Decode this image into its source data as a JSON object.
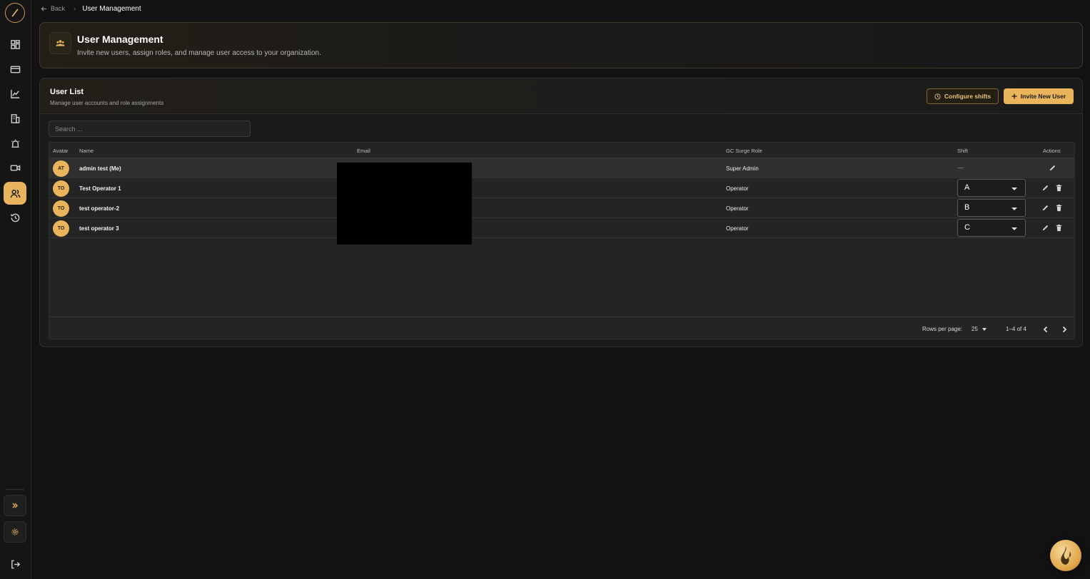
{
  "breadcrumb": {
    "back_label": "Back",
    "current": "User Management"
  },
  "sidebar": {
    "items": [
      {
        "icon": "dashboard-icon"
      },
      {
        "icon": "credit-card-icon"
      },
      {
        "icon": "line-chart-icon"
      },
      {
        "icon": "building-icon"
      },
      {
        "icon": "alarm-siren-icon"
      },
      {
        "icon": "video-camera-icon"
      },
      {
        "icon": "users-icon",
        "active": true
      },
      {
        "icon": "history-icon"
      }
    ],
    "expand_icon": "double-chevron-right-icon",
    "settings_icon": "gear-icon",
    "logout_icon": "logout-icon"
  },
  "header": {
    "title": "User Management",
    "subtitle": "Invite new users, assign roles, and manage user access to your organization."
  },
  "user_list": {
    "title": "User List",
    "subtitle": "Manage user accounts and role assignments",
    "configure_label": "Configure shifts",
    "invite_label": "Invite New User",
    "search_placeholder": "Search ...",
    "columns": {
      "avatar": "Avatar",
      "name": "Name",
      "email": "Email",
      "role": "GC Surge Role",
      "shift": "Shift",
      "actions": "Actions"
    },
    "rows": [
      {
        "initials": "AT",
        "name": "admin test (Me)",
        "role": "Super Admin",
        "shift": "—"
      },
      {
        "initials": "TO",
        "name": "Test Operator 1",
        "role": "Operator",
        "shift": "A"
      },
      {
        "initials": "TO",
        "name": "test operator-2",
        "role": "Operator",
        "shift": "B"
      },
      {
        "initials": "TO",
        "name": "test operator 3",
        "role": "Operator",
        "shift": "C"
      }
    ],
    "footer": {
      "rows_per_page_label": "Rows per page:",
      "rows_per_page": "25",
      "range": "1–4 of 4"
    }
  },
  "colors": {
    "accent": "#e9b45c",
    "background": "#121212",
    "card": "#1b1b1b"
  }
}
